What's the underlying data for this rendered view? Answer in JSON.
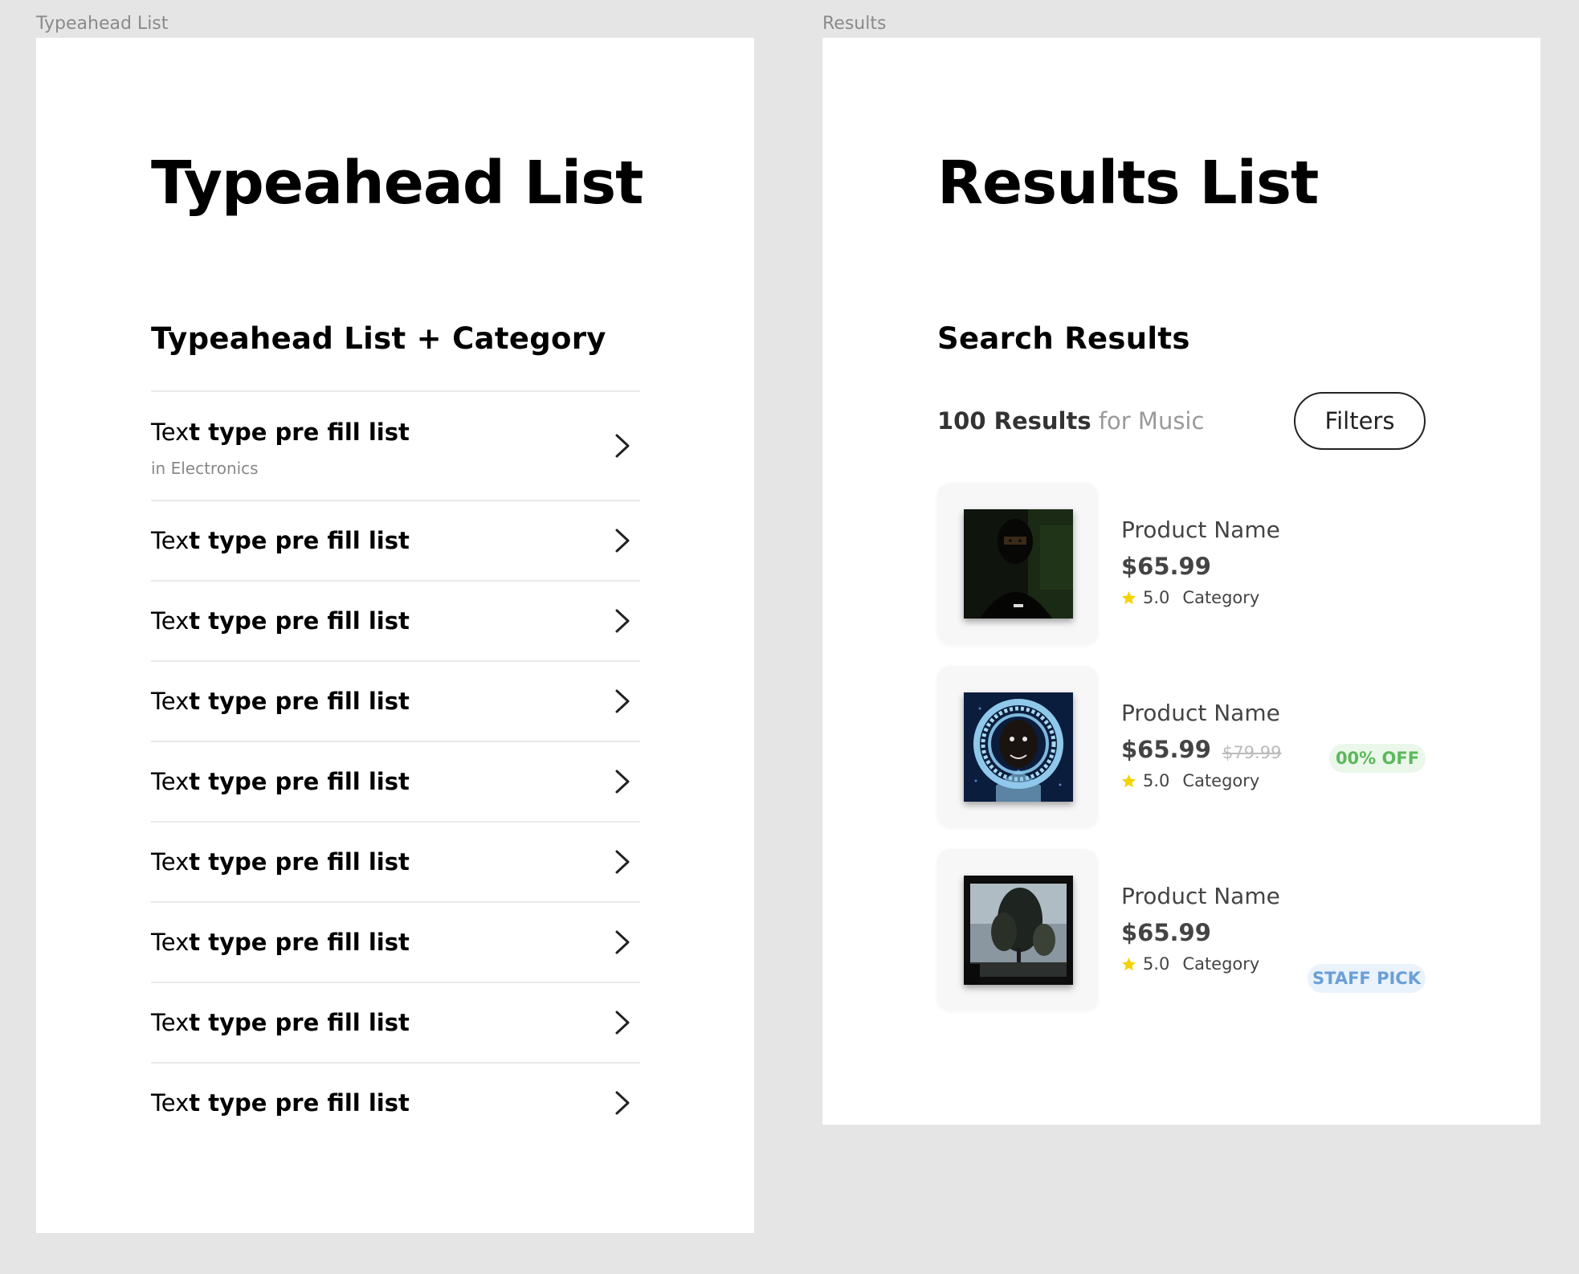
{
  "frames": {
    "left_label": "Typeahead List",
    "right_label": "Results"
  },
  "typeahead": {
    "title": "Typeahead List",
    "section_title": "Typeahead List + Category",
    "items": [
      {
        "prefix": "Tex",
        "rest": "t type pre fill list",
        "sub": "in Electronics"
      },
      {
        "prefix": "Tex",
        "rest": "t type pre fill list"
      },
      {
        "prefix": "Tex",
        "rest": "t type pre fill list"
      },
      {
        "prefix": "Tex",
        "rest": "t type pre fill list"
      },
      {
        "prefix": "Tex",
        "rest": "t type pre fill list"
      },
      {
        "prefix": "Tex",
        "rest": "t type pre fill list"
      },
      {
        "prefix": "Tex",
        "rest": "t type pre fill list"
      },
      {
        "prefix": "Tex",
        "rest": "t type pre fill list"
      },
      {
        "prefix": "Tex",
        "rest": "t type pre fill list"
      }
    ],
    "chevron_icon": "chevron-right-icon"
  },
  "results": {
    "title": "Results List",
    "section_title": "Search Results",
    "count": "100 Results",
    "query": "for Music",
    "filters_label": "Filters",
    "items": [
      {
        "name": "Product Name",
        "price": "$65.99",
        "old_price": "",
        "rating": "5.0",
        "category": "Category",
        "badge": "",
        "thumb": "hooded-figure-album-art"
      },
      {
        "name": "Product Name",
        "price": "$65.99",
        "old_price": "$79.99",
        "rating": "5.0",
        "category": "Category",
        "badge": "00% OFF",
        "thumb": "awaken-my-love-album-art"
      },
      {
        "name": "Product Name",
        "price": "$65.99",
        "old_price": "",
        "rating": "5.0",
        "category": "Category",
        "badge": "STAFF PICK",
        "thumb": "trees-album-art"
      }
    ],
    "star_icon": "star-icon"
  },
  "colors": {
    "background": "#e5e5e5",
    "frame": "#ffffff",
    "star": "#f5d300",
    "badge_off": "#5cb85c",
    "badge_staff": "#6a9fd8"
  }
}
